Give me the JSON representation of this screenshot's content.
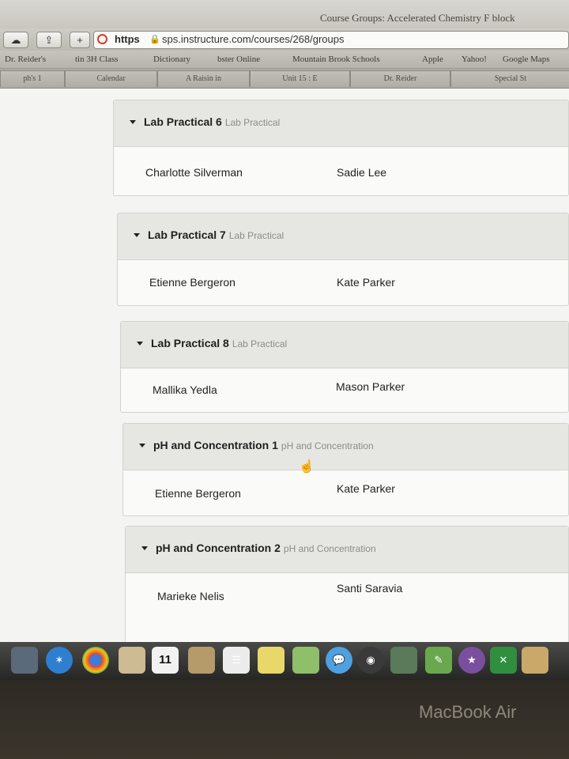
{
  "window": {
    "title": "Course Groups: Accelerated Chemistry F block"
  },
  "toolbar": {
    "add_label": "+",
    "url_scheme": "https",
    "url_rest": "sps.instructure.com/courses/268/groups"
  },
  "bookmarks": [
    "Dr. Reider's",
    "tin 3H Class",
    "Dictionary",
    "bster Online",
    "Mountain Brook Schools",
    "Apple",
    "Yahoo!",
    "Google Maps"
  ],
  "tabs": [
    "ph's 1",
    "Calendar",
    "A Raisin in",
    "Unit 15 : E",
    "Dr. Reider",
    "Special St"
  ],
  "groups": [
    {
      "name": "Lab Practical 6",
      "category": "Lab Practical",
      "members": [
        "Charlotte Silverman",
        "Sadie Lee"
      ]
    },
    {
      "name": "Lab Practical 7",
      "category": "Lab Practical",
      "members": [
        "Etienne Bergeron",
        "Kate Parker"
      ]
    },
    {
      "name": "Lab Practical 8",
      "category": "Lab Practical",
      "members": [
        "Mallika Yedla",
        "Mason Parker"
      ]
    },
    {
      "name": "pH and Concentration 1",
      "category": "pH and Concentration",
      "members": [
        "Etienne Bergeron",
        "Kate Parker"
      ]
    },
    {
      "name": "pH and Concentration 2",
      "category": "pH and Concentration",
      "members": [
        "Marieke Nelis",
        "Santi Saravia"
      ]
    }
  ],
  "dock": {
    "calendar_day": "11"
  },
  "device": {
    "brand": "MacBook Air"
  }
}
